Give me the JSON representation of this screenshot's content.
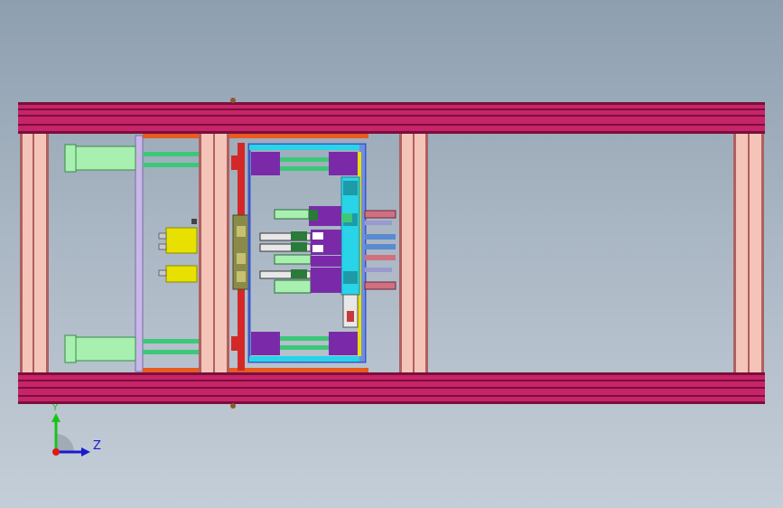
{
  "viewer": {
    "background_top": "#8e9fb0",
    "background_bottom": "#c4ced8"
  },
  "triad": {
    "y_label": "Y",
    "z_label": "Z",
    "y_color": "#18c418",
    "z_color": "#1a1ad0",
    "origin_color": "#e01818"
  },
  "colors": {
    "frame_rail": "#c8246a",
    "frame_rail_dark": "#7a0f3a",
    "column_light": "#f4c4b8",
    "column_line": "#b06060",
    "plate_blue": "#6f8de0",
    "plate_cyan": "#29d3e8",
    "purple_block": "#7a2aa8",
    "guide_green": "#3cc878",
    "cylinder_green": "#a8f0b0",
    "yellow_cylinder": "#e8e000",
    "red_plate": "#d42828",
    "lavender": "#c8b8e8",
    "orange_bar": "#e85a20",
    "olive": "#8a8a4a",
    "dark_green": "#2a7a3a"
  }
}
